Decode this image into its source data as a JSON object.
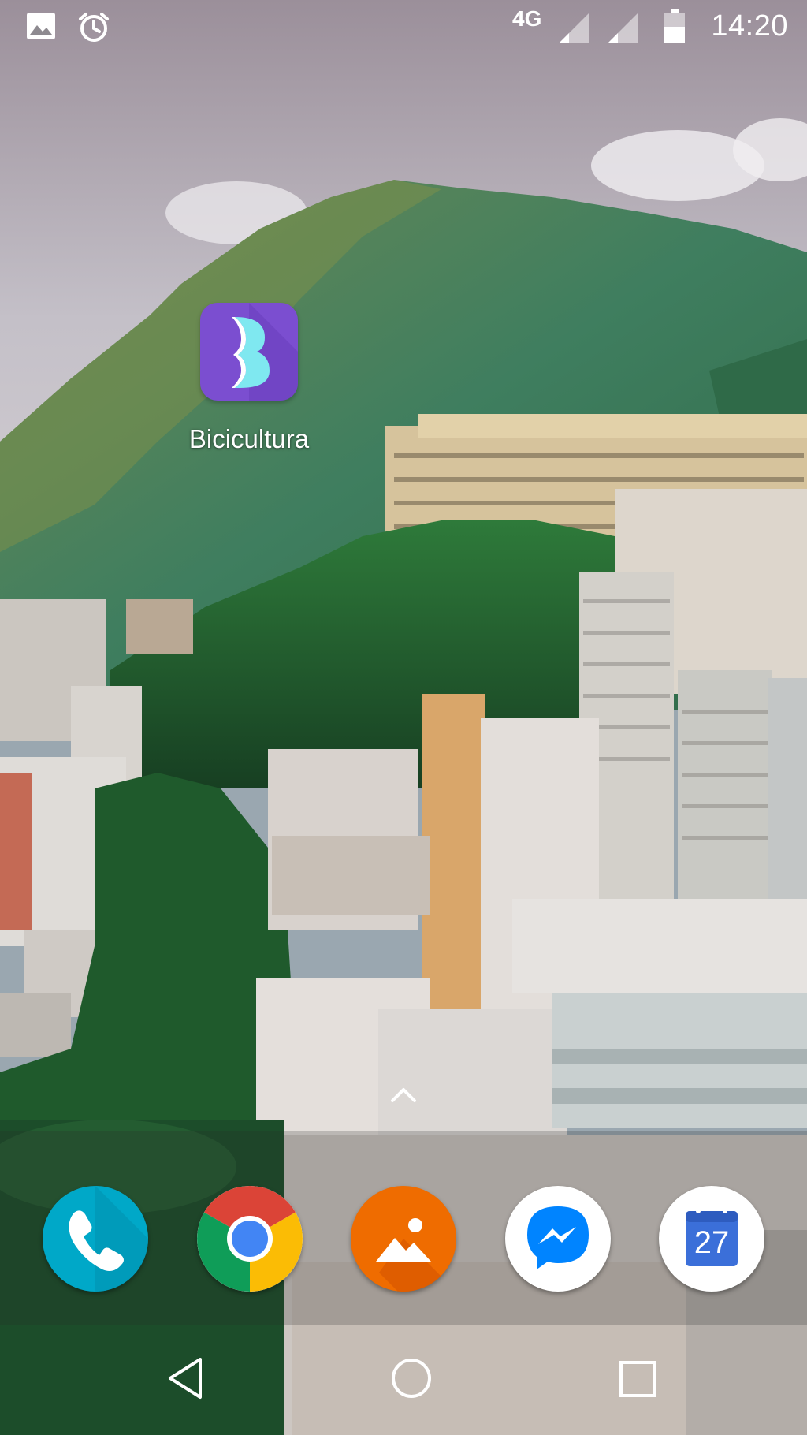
{
  "status_bar": {
    "network_type": "4G",
    "time": "14:20",
    "icons": [
      "image-icon",
      "alarm-icon",
      "signal-icon",
      "signal-icon-2",
      "battery-icon"
    ]
  },
  "home": {
    "shortcuts": [
      {
        "label": "Bicicultura",
        "icon": "bicicultura-app-icon",
        "color": "#7b4ed0"
      }
    ]
  },
  "dock": {
    "apps": [
      {
        "icon": "phone-app-icon",
        "color": "#00a8c8"
      },
      {
        "icon": "chrome-app-icon",
        "color": "#4285f4"
      },
      {
        "icon": "gallery-app-icon",
        "color": "#ef6c00"
      },
      {
        "icon": "messenger-app-icon",
        "color": "#0084ff"
      },
      {
        "icon": "calendar-app-icon",
        "color": "#3b6fd9",
        "text": "27"
      }
    ]
  },
  "nav_bar": {
    "buttons": [
      "back-icon",
      "home-icon",
      "recents-icon"
    ]
  }
}
